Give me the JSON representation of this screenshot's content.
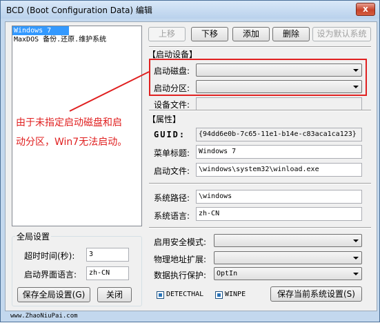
{
  "window": {
    "title": "BCD (Boot Configuration Data) 编辑",
    "close_symbol": "x"
  },
  "boot_list": {
    "items": [
      "Windows 7",
      "MaxDOS 备份.还原.维护系统"
    ],
    "selected_index": 0
  },
  "toolbar": {
    "move_up": "上移",
    "move_down": "下移",
    "add": "添加",
    "delete": "删除",
    "set_default": "设为默认系统"
  },
  "boot_device": {
    "section_title": "【启动设备】",
    "disk_label": "启动磁盘:",
    "disk_value": "",
    "partition_label": "启动分区:",
    "partition_value": "",
    "file_label": "设备文件:",
    "file_value": ""
  },
  "attributes": {
    "section_title": "【属性】",
    "guid_label": "GUID:",
    "guid_value": "{94dd6e0b-7c65-11e1-b14e-c83aca1ca123}",
    "menu_title_label": "菜单标题:",
    "menu_title_value": "Windows 7",
    "boot_file_label": "启动文件:",
    "boot_file_value": "\\windows\\system32\\winload.exe",
    "system_path_label": "系统路径:",
    "system_path_value": "\\windows",
    "system_lang_label": "系统语言:",
    "system_lang_value": "zh-CN"
  },
  "options": {
    "safe_mode_label": "启用安全模式:",
    "safe_mode_value": "",
    "pae_label": "物理地址扩展:",
    "pae_value": "",
    "dep_label": "数据执行保护:",
    "dep_value": "OptIn",
    "detecthal_label": "DETECTHAL",
    "winpe_label": "WINPE",
    "save_current": "保存当前系统设置(S)"
  },
  "global_settings": {
    "title": "全局设置",
    "timeout_label": "超时时间(秒):",
    "timeout_value": "3",
    "ui_lang_label": "启动界面语言:",
    "ui_lang_value": "zh-CN",
    "save_global": "保存全局设置(G)",
    "close": "关闭"
  },
  "annotation": {
    "line1": "由于未指定启动磁盘和启",
    "line2": "动分区，Win7无法启动。"
  },
  "status": {
    "watermark": "www.ZhaoNiuPai.com"
  },
  "colors": {
    "annotation_red": "#e02020",
    "selection_blue": "#3399ff"
  }
}
